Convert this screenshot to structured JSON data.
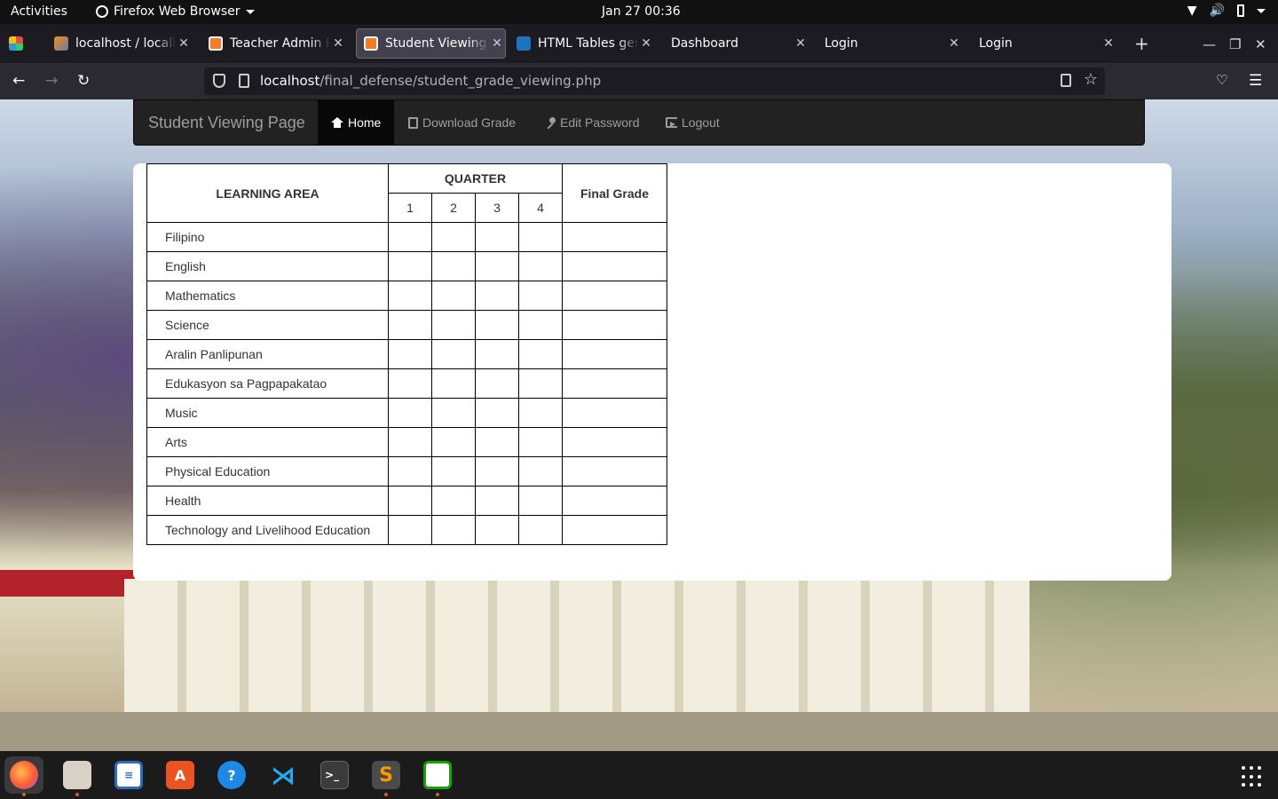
{
  "topbar": {
    "activities": "Activities",
    "app_name": "Firefox Web Browser",
    "clock": "Jan 27  00:36"
  },
  "tabs": [
    {
      "title": "localhost / localhost",
      "icon": "phpmyadmin-icon"
    },
    {
      "title": "Teacher Admin Page",
      "icon": "xampp-icon"
    },
    {
      "title": "Student Viewing Page",
      "icon": "xampp-icon",
      "active": true
    },
    {
      "title": "HTML Tables generator",
      "icon": "tables-generator-icon"
    },
    {
      "title": "Dashboard",
      "icon": ""
    },
    {
      "title": "Login",
      "icon": ""
    },
    {
      "title": "Login",
      "icon": ""
    }
  ],
  "urlbar": {
    "host": "localhost",
    "path": "/final_defense/student_grade_viewing.php"
  },
  "site_nav": {
    "brand": "Student Viewing Page",
    "items": [
      {
        "label": "Home",
        "icon": "home-icon",
        "active": true
      },
      {
        "label": "Download Grade",
        "icon": "download-document-icon"
      },
      {
        "label": "Edit Password",
        "icon": "key-icon"
      },
      {
        "label": "Logout",
        "icon": "logout-icon"
      }
    ]
  },
  "grades_table": {
    "headers": {
      "learning_area": "LEARNING AREA",
      "quarter": "QUARTER",
      "final_grade": "Final Grade",
      "quarters": [
        "1",
        "2",
        "3",
        "4"
      ]
    },
    "rows": [
      {
        "subject": "Filipino",
        "q1": "",
        "q2": "",
        "q3": "",
        "q4": "",
        "final": ""
      },
      {
        "subject": "English",
        "q1": "",
        "q2": "",
        "q3": "",
        "q4": "",
        "final": ""
      },
      {
        "subject": "Mathematics",
        "q1": "",
        "q2": "",
        "q3": "",
        "q4": "",
        "final": ""
      },
      {
        "subject": "Science",
        "q1": "",
        "q2": "",
        "q3": "",
        "q4": "",
        "final": ""
      },
      {
        "subject": "Aralin Panlipunan",
        "q1": "",
        "q2": "",
        "q3": "",
        "q4": "",
        "final": ""
      },
      {
        "subject": "Edukasyon sa Pagpapakatao",
        "q1": "",
        "q2": "",
        "q3": "",
        "q4": "",
        "final": ""
      },
      {
        "subject": "Music",
        "q1": "",
        "q2": "",
        "q3": "",
        "q4": "",
        "final": ""
      },
      {
        "subject": "Arts",
        "q1": "",
        "q2": "",
        "q3": "",
        "q4": "",
        "final": ""
      },
      {
        "subject": "Physical Education",
        "q1": "",
        "q2": "",
        "q3": "",
        "q4": "",
        "final": ""
      },
      {
        "subject": "Health",
        "q1": "",
        "q2": "",
        "q3": "",
        "q4": "",
        "final": ""
      },
      {
        "subject": "Technology and Livelihood Education",
        "q1": "",
        "q2": "",
        "q3": "",
        "q4": "",
        "final": ""
      }
    ]
  },
  "dock": [
    {
      "name": "firefox-icon",
      "active": true
    },
    {
      "name": "files-icon"
    },
    {
      "name": "libreoffice-writer-icon"
    },
    {
      "name": "software-center-icon"
    },
    {
      "name": "help-icon"
    },
    {
      "name": "vscode-icon"
    },
    {
      "name": "terminal-icon"
    },
    {
      "name": "sublime-text-icon",
      "running": true
    },
    {
      "name": "libreoffice-calc-icon",
      "running": true
    }
  ]
}
